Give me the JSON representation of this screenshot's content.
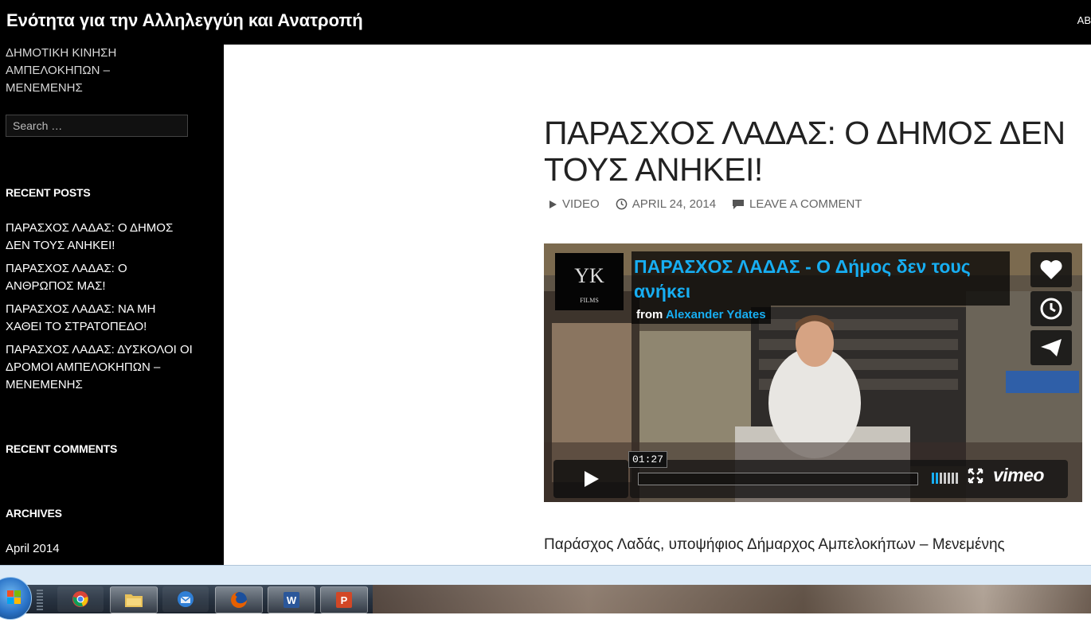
{
  "header": {
    "site_title": "Ενότητα για την Αλληλεγγύη και Ανατροπή",
    "nav_partial": "ΑΒ"
  },
  "sidebar": {
    "tagline": "ΔΗΜΟΤΙΚΗ ΚΙΝΗΣΗ ΑΜΠΕΛΟΚΗΠΩΝ – ΜΕΝΕΜΕΝΗΣ",
    "search_placeholder": "Search …",
    "recent_posts_title": "RECENT POSTS",
    "recent_posts": [
      {
        "label": "ΠΑΡΑΣΧΟΣ ΛΑΔΑΣ: Ο ΔΗΜΟΣ ΔΕΝ ΤΟΥΣ ΑΝΗΚΕΙ!"
      },
      {
        "label": "ΠΑΡΑΣΧΟΣ ΛΑΔΑΣ: Ο ΑΝΘΡΩΠΟΣ ΜΑΣ!"
      },
      {
        "label": "ΠΑΡΑΣΧΟΣ ΛΑΔΑΣ: ΝΑ ΜΗ ΧΑΘΕΙ ΤΟ ΣΤΡΑΤΟΠΕΔΟ!"
      },
      {
        "label": "ΠΑΡΑΣΧΟΣ ΛΑΔΑΣ: ΔΥΣΚΟΛΟΙ ΟΙ ΔΡΟΜΟΙ ΑΜΠΕΛΟΚΗΠΩΝ – ΜΕΝΕΜΕΝΗΣ"
      }
    ],
    "recent_comments_title": "RECENT COMMENTS",
    "archives_title": "ARCHIVES",
    "archive_month": "April 2014"
  },
  "post": {
    "title": "ΠΑΡΑΣΧΟΣ ΛΑΔΑΣ: Ο ΔΗΜΟΣ ΔΕΝ ΤΟΥΣ ΑΝΗΚΕΙ!",
    "format": "VIDEO",
    "date": "APRIL 24, 2014",
    "comment_link": "LEAVE A COMMENT",
    "body": "Παράσχος Λαδάς, υποψήφιος Δήμαρχος Αμπελοκήπων – Μενεμένης"
  },
  "video": {
    "logo_text": "YK",
    "logo_sub": "FILMS",
    "title": "ΠΑΡΑΣΧΟΣ ΛΑΔΑΣ - Ο Δήμος δεν τους ανήκει",
    "from_label": "from",
    "author": "Alexander Ydates",
    "timecode": "01:27",
    "brand": "vimeo",
    "progress": 0,
    "volume_level": 0.4,
    "accent_color": "#17aef2"
  },
  "taskbar": {
    "apps": [
      {
        "icon": "chrome-icon"
      },
      {
        "icon": "explorer-folder-icon"
      },
      {
        "icon": "thunderbird-icon"
      },
      {
        "icon": "firefox-icon"
      },
      {
        "icon": "word-icon"
      },
      {
        "icon": "powerpoint-icon"
      }
    ]
  }
}
